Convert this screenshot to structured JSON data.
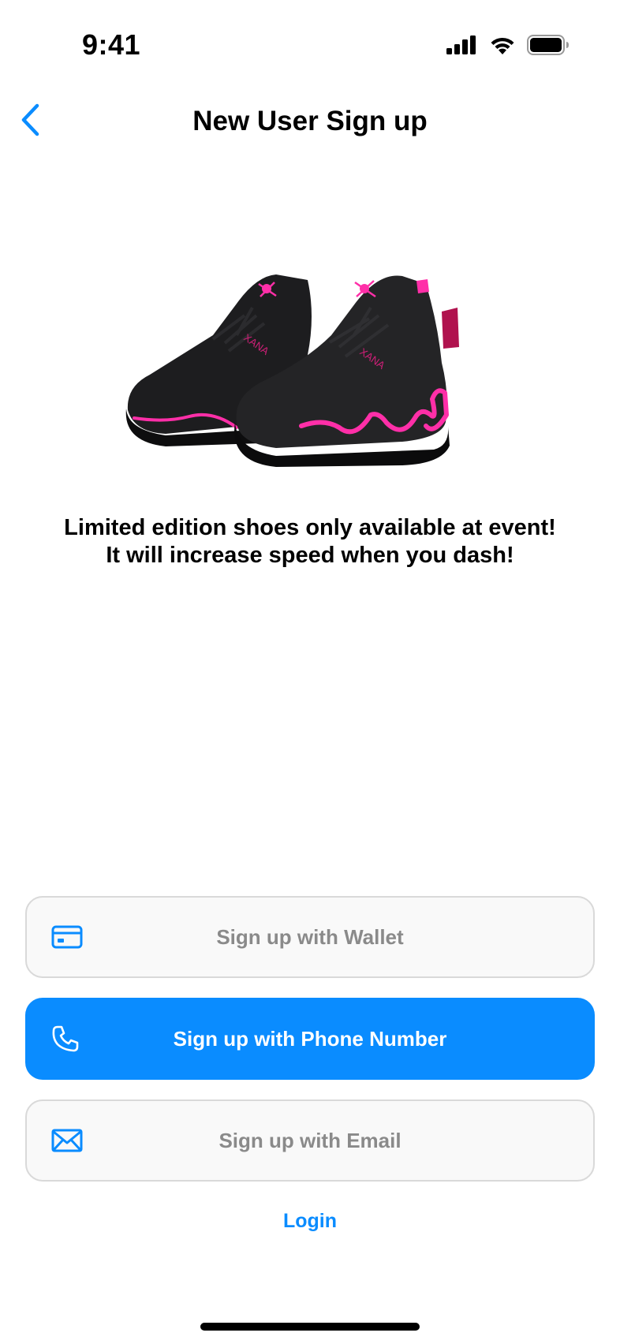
{
  "status_bar": {
    "time": "9:41"
  },
  "nav": {
    "title": "New User Sign up"
  },
  "promo": {
    "line1": "Limited edition shoes only available at event!",
    "line2": "It will increase speed when you dash!"
  },
  "buttons": [
    {
      "label": "Sign up with Wallet",
      "icon": "wallet-card-icon",
      "style": "outline"
    },
    {
      "label": "Sign up with Phone Number",
      "icon": "phone-icon",
      "style": "primary"
    },
    {
      "label": "Sign up with Email",
      "icon": "mail-icon",
      "style": "outline"
    }
  ],
  "login": {
    "label": "Login"
  },
  "shoe": {
    "brand_text": "XANA"
  },
  "colors": {
    "accent": "#0a8cff",
    "shoe_body": "#1c1c1e",
    "shoe_glow": "#ff2fa8"
  }
}
